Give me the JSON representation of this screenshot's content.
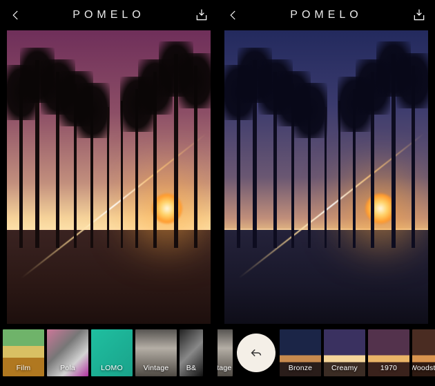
{
  "left": {
    "app_title": "POMELO",
    "filters": [
      {
        "label": "Film"
      },
      {
        "label": "Pola"
      },
      {
        "label": "LOMO"
      },
      {
        "label": "Vintage"
      },
      {
        "label": "B&"
      }
    ]
  },
  "right": {
    "app_title": "POMELO",
    "current_category": "Vintage",
    "presets": [
      {
        "label": "Bronze"
      },
      {
        "label": "Creamy"
      },
      {
        "label": "1970"
      },
      {
        "label": "Woodstoc"
      }
    ]
  }
}
